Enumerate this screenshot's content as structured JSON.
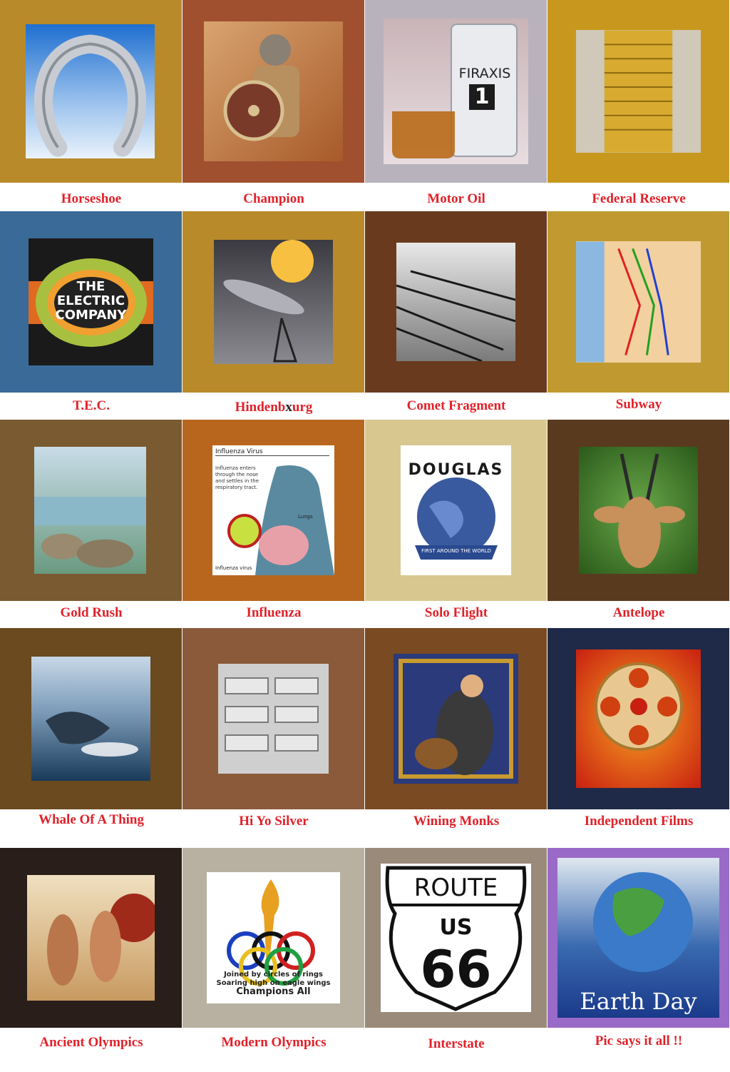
{
  "tiles": [
    {
      "caption": "Horseshoe"
    },
    {
      "caption": "Champion"
    },
    {
      "caption": "Motor Oil",
      "bottle_text": "FIRAXIS",
      "bottle_number": "1"
    },
    {
      "caption": "Federal Reserve"
    },
    {
      "caption": "T.E.C.",
      "logo_text": [
        "THE",
        "ELECTRIC",
        "COMPANY"
      ]
    },
    {
      "caption_before": "Hindenb",
      "caption_mark": "x",
      "caption_after": "urg"
    },
    {
      "caption": "Comet Fragment"
    },
    {
      "caption": "Subway"
    },
    {
      "caption": "Gold Rush"
    },
    {
      "caption": "Influenza",
      "diagram_title": "Influenza Virus",
      "diagram_lines": [
        "Influenza enters",
        "through the nose",
        "and settles in the",
        "respiratory tract."
      ],
      "diagram_label_lungs": "Lungs",
      "diagram_label_virus": "Influenza virus"
    },
    {
      "caption": "Solo Flight",
      "logo_text": "DOUGLAS",
      "logo_sub": "FIRST AROUND THE WORLD"
    },
    {
      "caption": "Antelope"
    },
    {
      "caption": "Whale Of A Thing"
    },
    {
      "caption": "Hi Yo Silver"
    },
    {
      "caption": "Wining Monks"
    },
    {
      "caption": "Independent Films"
    },
    {
      "caption": "Ancient Olympics"
    },
    {
      "caption": "Modern Olympics",
      "poem": [
        "Joined by circles of rings",
        "Soaring high on eagle wings",
        "Champions All"
      ]
    },
    {
      "caption": "Interstate",
      "sign_top": "ROUTE",
      "sign_mid": "US",
      "sign_num": "66"
    },
    {
      "caption": "Pic says it all !!",
      "art_text": "Earth Day"
    }
  ]
}
